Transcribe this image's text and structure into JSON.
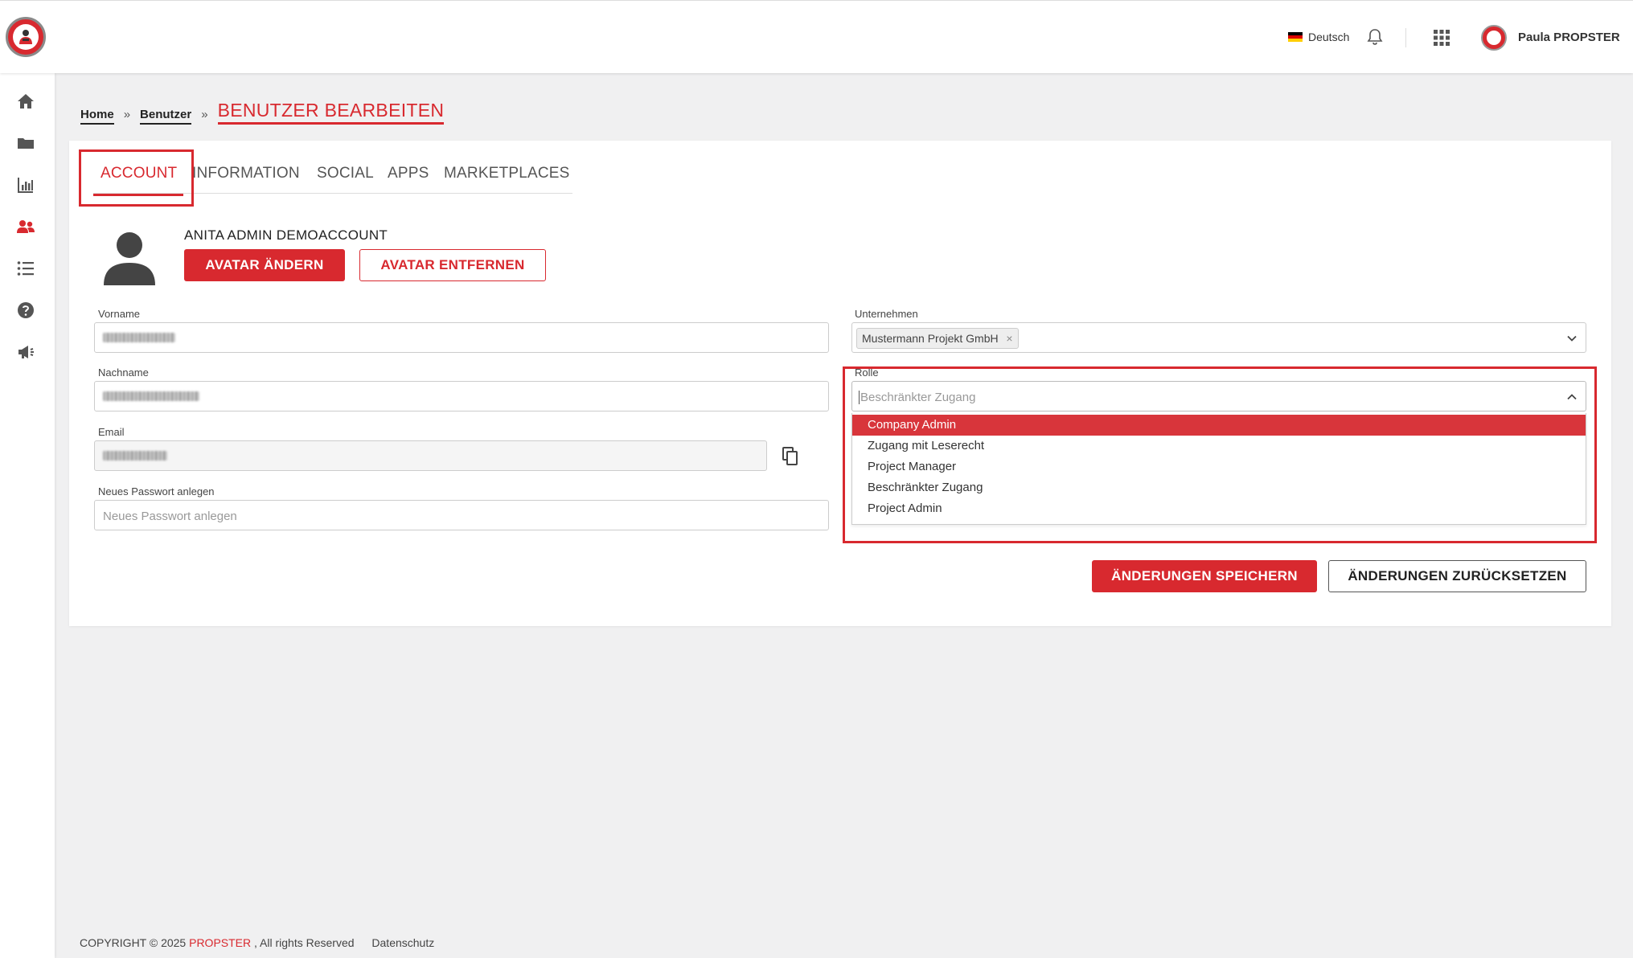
{
  "header": {
    "language": "Deutsch",
    "user_name": "Paula PROPSTER"
  },
  "sidebar": {
    "items": [
      {
        "icon": "home-icon"
      },
      {
        "icon": "folder-icon"
      },
      {
        "icon": "chart-icon"
      },
      {
        "icon": "users-icon",
        "active": true
      },
      {
        "icon": "list-icon"
      },
      {
        "icon": "help-icon"
      },
      {
        "icon": "megaphone-icon"
      }
    ]
  },
  "breadcrumb": {
    "home": "Home",
    "separator": "»",
    "users": "Benutzer",
    "current": "BENUTZER BEARBEITEN"
  },
  "tabs": {
    "account": "ACCOUNT",
    "information": "INFORMATION",
    "social": "SOCIAL",
    "apps": "APPS",
    "marketplaces": "MARKETPLACES"
  },
  "profile": {
    "display_name": "ANITA ADMIN DEMOACCOUNT",
    "change_avatar": "AVATAR ÄNDERN",
    "remove_avatar": "AVATAR ENTFERNEN"
  },
  "form": {
    "vorname_label": "Vorname",
    "nachname_label": "Nachname",
    "email_label": "Email",
    "password_label": "Neues Passwort anlegen",
    "password_placeholder": "Neues Passwort anlegen",
    "company_label": "Unternehmen",
    "company_value": "Mustermann Projekt GmbH",
    "role_label": "Rolle",
    "role_placeholder": "Beschränkter Zugang",
    "role_options": [
      "Company Admin",
      "Zugang mit Leserecht",
      "Project Manager",
      "Beschränkter Zugang",
      "Project Admin"
    ],
    "role_highlighted": "Company Admin"
  },
  "actions": {
    "save": "ÄNDERUNGEN SPEICHERN",
    "reset": "ÄNDERUNGEN ZURÜCKSETZEN"
  },
  "footer": {
    "copyright": "COPYRIGHT © 2025",
    "brand": "PROPSTER",
    "rights": ", All rights Reserved",
    "privacy": "Datenschutz"
  },
  "colors": {
    "accent": "#d8292f",
    "background": "#f0f0f1"
  }
}
